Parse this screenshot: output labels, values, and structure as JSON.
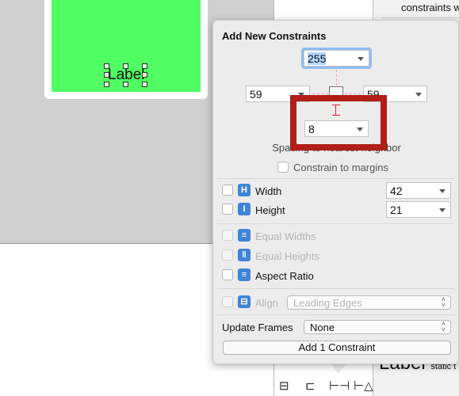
{
  "canvas": {
    "scene_label": "Label",
    "scene_color": "#50fd62"
  },
  "inspector": {
    "top_text": "constraints w",
    "bottom_label": "Label",
    "bottom_sub": "static t"
  },
  "popover": {
    "title": "Add New Constraints",
    "spacing": {
      "top": "255",
      "left": "59",
      "right": "59",
      "bottom": "8"
    },
    "spacing_caption": "Spacing to nearest neighbor",
    "constrain_to_margins": "Constrain to margins",
    "width": {
      "label": "Width",
      "value": "42",
      "icon": "width-icon"
    },
    "height": {
      "label": "Height",
      "value": "21",
      "icon": "height-icon"
    },
    "equal_widths": "Equal Widths",
    "equal_heights": "Equal Heights",
    "aspect_ratio": "Aspect Ratio",
    "align": {
      "label": "Align",
      "value": "Leading Edges"
    },
    "update_frames": {
      "label": "Update Frames",
      "value": "None"
    },
    "add_button": "Add 1 Constraint"
  },
  "highlight_color": "#b01e17",
  "toolbar": [
    "stack-icon",
    "align-icon",
    "pin-icon",
    "resolve-icon"
  ]
}
